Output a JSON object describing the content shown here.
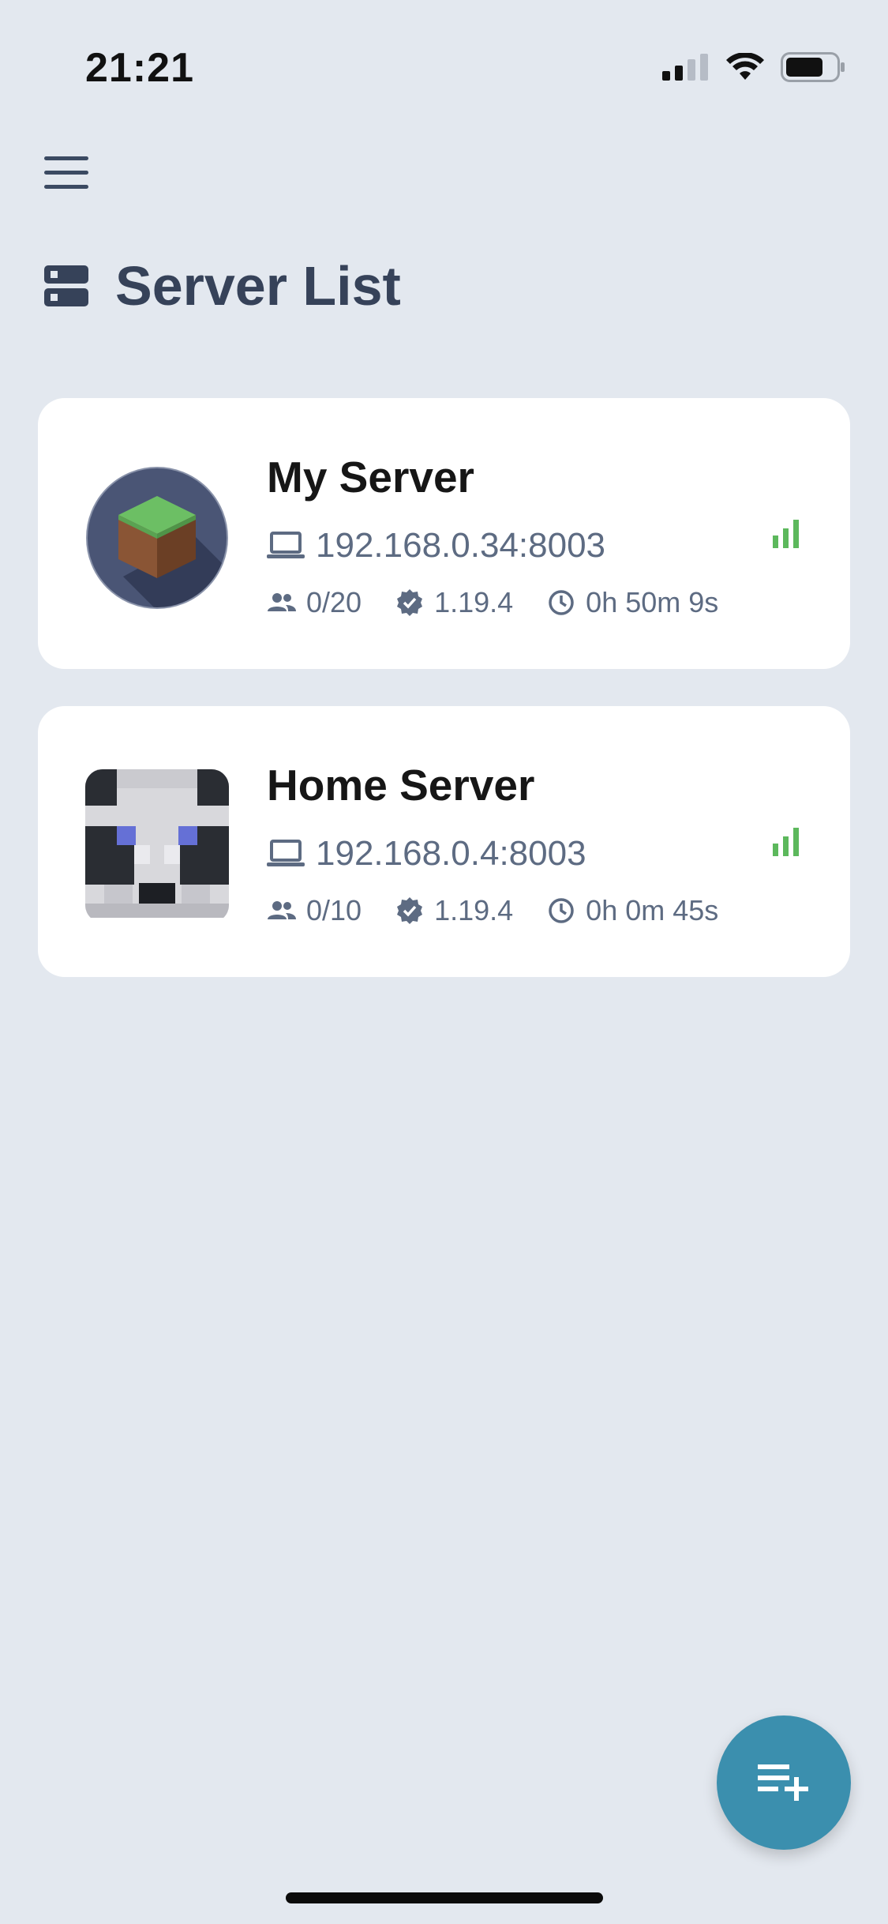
{
  "status_bar": {
    "time": "21:21",
    "icons": [
      "cellular-signal-icon",
      "wifi-icon",
      "battery-icon"
    ]
  },
  "header": {
    "menu_icon": "hamburger-menu-icon",
    "title_icon": "server-icon",
    "title": "Server List"
  },
  "servers": [
    {
      "name": "My Server",
      "address": "192.168.0.34:8003",
      "players": "0/20",
      "version": "1.19.4",
      "uptime": "0h 50m 9s",
      "avatar": "grass-block-avatar",
      "status_icon": "signal-bars-icon"
    },
    {
      "name": "Home Server",
      "address": "192.168.0.4:8003",
      "players": "0/10",
      "version": "1.19.4",
      "uptime": "0h 0m 45s",
      "avatar": "panda-avatar",
      "status_icon": "signal-bars-icon"
    }
  ],
  "fab": {
    "icon": "playlist-add-icon"
  },
  "colors": {
    "background": "#e3e8ef",
    "card": "#ffffff",
    "accent": "#3b8fae",
    "signal_green": "#5cb85c",
    "muted_text": "#5d6b82",
    "title_text": "#364259"
  }
}
